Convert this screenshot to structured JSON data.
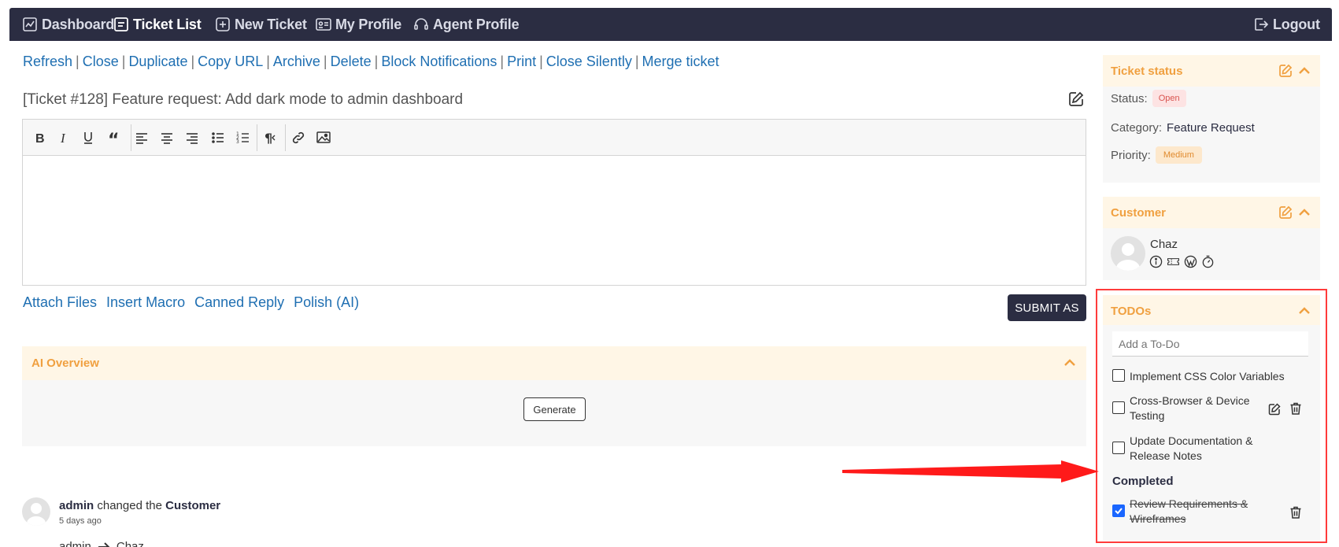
{
  "nav": {
    "items": [
      {
        "label": "Dashboard",
        "icon": "chart-icon"
      },
      {
        "label": "Ticket List",
        "icon": "list-icon"
      },
      {
        "label": "New Ticket",
        "icon": "plus-square-icon"
      },
      {
        "label": "My Profile",
        "icon": "id-card-icon"
      },
      {
        "label": "Agent Profile",
        "icon": "headset-icon"
      }
    ],
    "logout": "Logout"
  },
  "actions": [
    "Refresh",
    "Close",
    "Duplicate",
    "Copy URL",
    "Archive",
    "Delete",
    "Block Notifications",
    "Print",
    "Close Silently",
    "Merge ticket"
  ],
  "ticket": {
    "title": "[Ticket #128] Feature request: Add dark mode to admin dashboard"
  },
  "editor": {
    "toolbar": [
      "bold-icon",
      "italic-icon",
      "underline-icon",
      "quote-icon",
      "align-left-icon",
      "align-center-icon",
      "align-right-icon",
      "bullet-list-icon",
      "numbered-list-icon",
      "pilcrow-icon",
      "link-icon",
      "image-icon"
    ]
  },
  "reply": {
    "links": [
      "Attach Files",
      "Insert Macro",
      "Canned Reply",
      "Polish (AI)"
    ],
    "submit": "SUBMIT AS"
  },
  "ai_overview": {
    "title": "AI Overview",
    "generate": "Generate"
  },
  "activity": {
    "actor": "admin",
    "action": "changed the",
    "field": "Customer",
    "time": "5 days ago",
    "from": "admin",
    "to": "Chaz"
  },
  "status_panel": {
    "title": "Ticket status",
    "status_label": "Status:",
    "status_value": "Open",
    "category_label": "Category:",
    "category_value": "Feature Request",
    "priority_label": "Priority:",
    "priority_value": "Medium",
    "colors": {
      "accent": "#f0a040",
      "open": "#d9534f",
      "medium": "#e08a2e"
    }
  },
  "customer_panel": {
    "title": "Customer",
    "name": "Chaz"
  },
  "todos": {
    "title": "TODOs",
    "placeholder": "Add a To-Do",
    "items": [
      {
        "text": "Implement CSS Color Variables",
        "checked": false
      },
      {
        "text": "Cross-Browser & Device Testing",
        "checked": false
      },
      {
        "text": "Update Documentation & Release Notes",
        "checked": false
      }
    ],
    "completed_label": "Completed",
    "completed": [
      {
        "text": "Review Requirements & Wireframes",
        "checked": true
      }
    ]
  }
}
